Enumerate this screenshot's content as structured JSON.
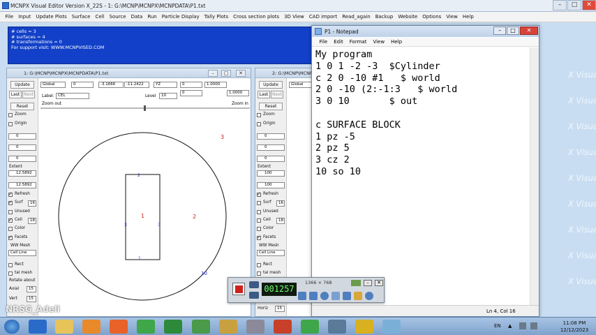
{
  "app": {
    "title": "MCNPX Visual Editor Version X_22S  - 1:  G:\\MCNP\\MCNPX\\MCNPDATA\\P1.txt",
    "menu": [
      "File",
      "Input",
      "Update Plots",
      "Surface",
      "Cell",
      "Source",
      "Data",
      "Run",
      "Particle Display",
      "Tally Plots",
      "Cross section plots",
      "3D View",
      "CAD import",
      "Read_again",
      "Backup",
      "Website",
      "Options",
      "View",
      "Help"
    ]
  },
  "info": {
    "lines": [
      "# cells = 3",
      "# surfaces = 4",
      "# transformations = 0",
      "For support visit: WWW.MCNPVISED.COM"
    ]
  },
  "plot1": {
    "title": "1: G:\\MCNP\\MCNPX\\MCNPDATA\\P1.txt",
    "basis": "Global",
    "origin_x": "0",
    "origin_y": "-3.1666",
    "origin_z": "-11.2422",
    "plane": "YZ",
    "ext_a": "0",
    "ext_b": "1.0000",
    "ext_c": "0",
    "ext_d": "1.0000",
    "label_caption": "Label:",
    "label_value": "CEL",
    "level_caption": "Level",
    "level_value": "10",
    "zoom_out": "Zoom out",
    "zoom_in": "Zoom in",
    "side": {
      "update": "Update",
      "last": "Last",
      "next": "Next",
      "reset": "Reset",
      "zoom": "Zoom",
      "origin": "Origin",
      "v1": "0",
      "v2": "0",
      "v3": "0",
      "extent": "Extent",
      "e1": "12.5892",
      "e2": "12.5892",
      "refresh": "Refresh",
      "surf": "Surf",
      "surf_n": "16",
      "unused": "Unused",
      "cell": "Cell",
      "cell_n": "18",
      "color": "Color",
      "facets": "Facets",
      "wwmesh": "WW Mesh",
      "cellline": "Cell Line",
      "rect": "Rect",
      "talmesh": "tal mesh",
      "rotate": "Rotate about",
      "axial": "Axial",
      "axial_n": "15",
      "vert": "Vert",
      "vert_n": "15"
    },
    "labels": [
      "3",
      "2",
      "1",
      "2",
      "3",
      "3",
      "1",
      "10"
    ]
  },
  "plot2": {
    "title": "2: G:\\MCNP\\MCNPX\\MCNPDATA\\P1.txt",
    "basis": "Global",
    "side": {
      "update": "Update",
      "last": "Last",
      "next": "Next",
      "reset": "Reset",
      "zoom": "Zoom",
      "origin": "Origin",
      "v1": "0",
      "v2": "0",
      "v3": "0",
      "extent": "Extent",
      "e1": "100",
      "e2": "100",
      "refresh": "Refresh",
      "surf": "Surf",
      "surf_n": "16",
      "unused": "Unused",
      "cell": "Cell",
      "cell_n": "18",
      "color": "Color",
      "facets": "Facets",
      "wwmesh": "WW Mesh",
      "cellline": "Cell Line",
      "rect": "Rect",
      "talmesh": "tal mesh",
      "horiz": "Horiz",
      "horiz_n": "15"
    },
    "watermark": "X Visual Edito"
  },
  "notepad": {
    "title": "P1 - Notepad",
    "menu": [
      "File",
      "Edit",
      "Format",
      "View",
      "Help"
    ],
    "lines": [
      "My program",
      "1 0 1 -2 -3  $Cylinder",
      "c 2 0 -10 #1   $ world",
      "2 0 -10 (2:-1:3   $ world",
      "3 0 10       $ out",
      "",
      "c SURFACE BLOCK",
      "1 pz -5",
      "2 pz 5",
      "3 cz 2",
      "10 so 10"
    ],
    "status": "Ln 4, Col 16"
  },
  "recorder": {
    "time": "001257",
    "resolution": "1366 × 768"
  },
  "overlay": {
    "user": "NRSG_Adeli"
  },
  "taskbar": {
    "lang": "EN",
    "time": "11:08 PM",
    "date": "12/12/2023"
  },
  "colors": {
    "info_bg": "#1240c8",
    "rect_color": "#1a1a1a",
    "label_red": "#d02020",
    "label_blue": "#2030c0"
  }
}
